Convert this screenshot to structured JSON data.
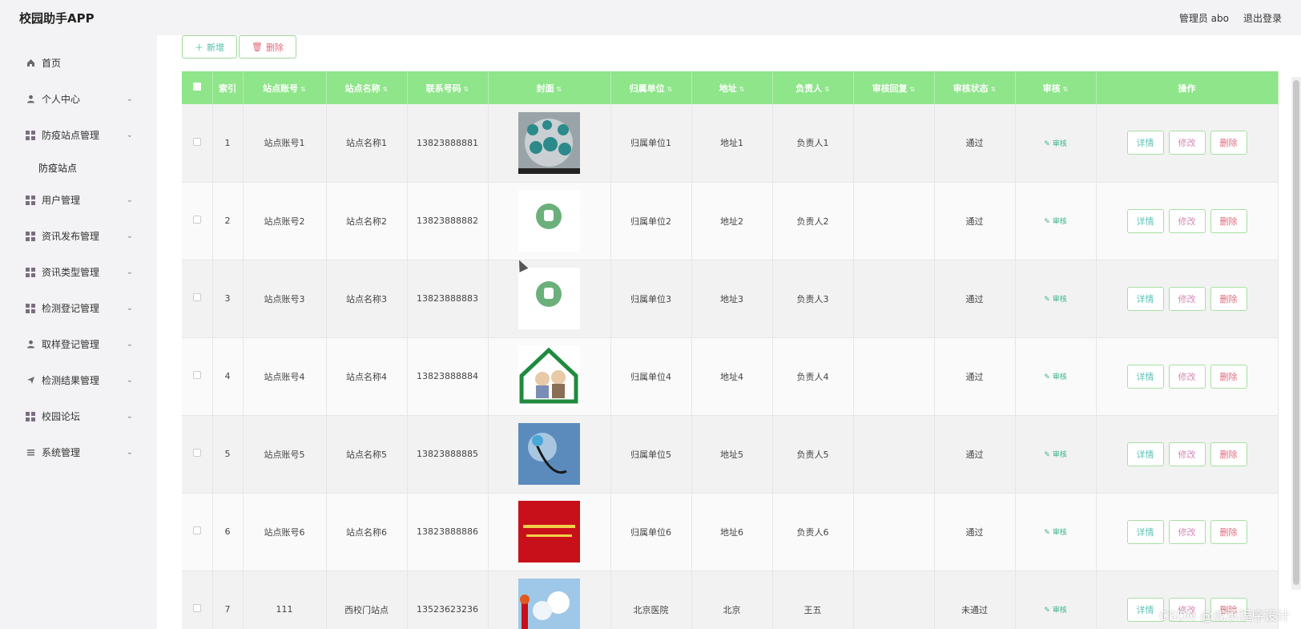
{
  "app": {
    "title": "校园助手APP"
  },
  "header": {
    "admin_label": "管理员 abo",
    "logout_label": "退出登录"
  },
  "sidebar": {
    "items": [
      {
        "label": "首页",
        "icon": "home-icon",
        "has_sub": false
      },
      {
        "label": "个人中心",
        "icon": "user-icon",
        "has_sub": true
      },
      {
        "label": "防疫站点管理",
        "icon": "grid-icon",
        "has_sub": true,
        "sub": [
          "防疫站点"
        ]
      },
      {
        "label": "用户管理",
        "icon": "grid-icon",
        "has_sub": true
      },
      {
        "label": "资讯发布管理",
        "icon": "grid-icon",
        "has_sub": true
      },
      {
        "label": "资讯类型管理",
        "icon": "grid-icon",
        "has_sub": true
      },
      {
        "label": "检测登记管理",
        "icon": "grid-icon",
        "has_sub": true
      },
      {
        "label": "取样登记管理",
        "icon": "user-icon",
        "has_sub": true
      },
      {
        "label": "检测结果管理",
        "icon": "send-icon",
        "has_sub": true
      },
      {
        "label": "校园论坛",
        "icon": "grid-icon",
        "has_sub": true
      },
      {
        "label": "系统管理",
        "icon": "menu-icon",
        "has_sub": true
      }
    ]
  },
  "toolbar": {
    "add_label": "新增",
    "delete_label": "删除"
  },
  "table": {
    "headers": [
      "索引",
      "站点账号",
      "站点名称",
      "联系号码",
      "封面",
      "归属单位",
      "地址",
      "负责人",
      "审核回复",
      "审核状态",
      "审核",
      "操作"
    ],
    "review_link": "审核",
    "ops": {
      "detail": "详情",
      "edit": "修改",
      "delete": "删除"
    },
    "rows": [
      {
        "index": "1",
        "account": "站点账号1",
        "name": "站点名称1",
        "phone": "13823888881",
        "unit": "归属单位1",
        "address": "地址1",
        "owner": "负责人1",
        "reply": "",
        "status": "通过"
      },
      {
        "index": "2",
        "account": "站点账号2",
        "name": "站点名称2",
        "phone": "13823888882",
        "unit": "归属单位2",
        "address": "地址2",
        "owner": "负责人2",
        "reply": "",
        "status": "通过"
      },
      {
        "index": "3",
        "account": "站点账号3",
        "name": "站点名称3",
        "phone": "13823888883",
        "unit": "归属单位3",
        "address": "地址3",
        "owner": "负责人3",
        "reply": "",
        "status": "通过"
      },
      {
        "index": "4",
        "account": "站点账号4",
        "name": "站点名称4",
        "phone": "13823888884",
        "unit": "归属单位4",
        "address": "地址4",
        "owner": "负责人4",
        "reply": "",
        "status": "通过"
      },
      {
        "index": "5",
        "account": "站点账号5",
        "name": "站点名称5",
        "phone": "13823888885",
        "unit": "归属单位5",
        "address": "地址5",
        "owner": "负责人5",
        "reply": "",
        "status": "通过"
      },
      {
        "index": "6",
        "account": "站点账号6",
        "name": "站点名称6",
        "phone": "13823888886",
        "unit": "归属单位6",
        "address": "地址6",
        "owner": "负责人6",
        "reply": "",
        "status": "通过"
      },
      {
        "index": "7",
        "account": "111",
        "name": "西校门站点",
        "phone": "13523623236",
        "unit": "北京医院",
        "address": "北京",
        "owner": "王五",
        "reply": "",
        "status": "未通过"
      }
    ]
  },
  "watermark": "CSDN @成承程序设计",
  "colors": {
    "header_green": "#8fe58a",
    "sidebar_bg": "#f3f3f5",
    "accent_teal": "#3ab58a",
    "danger": "#e06a7c"
  }
}
